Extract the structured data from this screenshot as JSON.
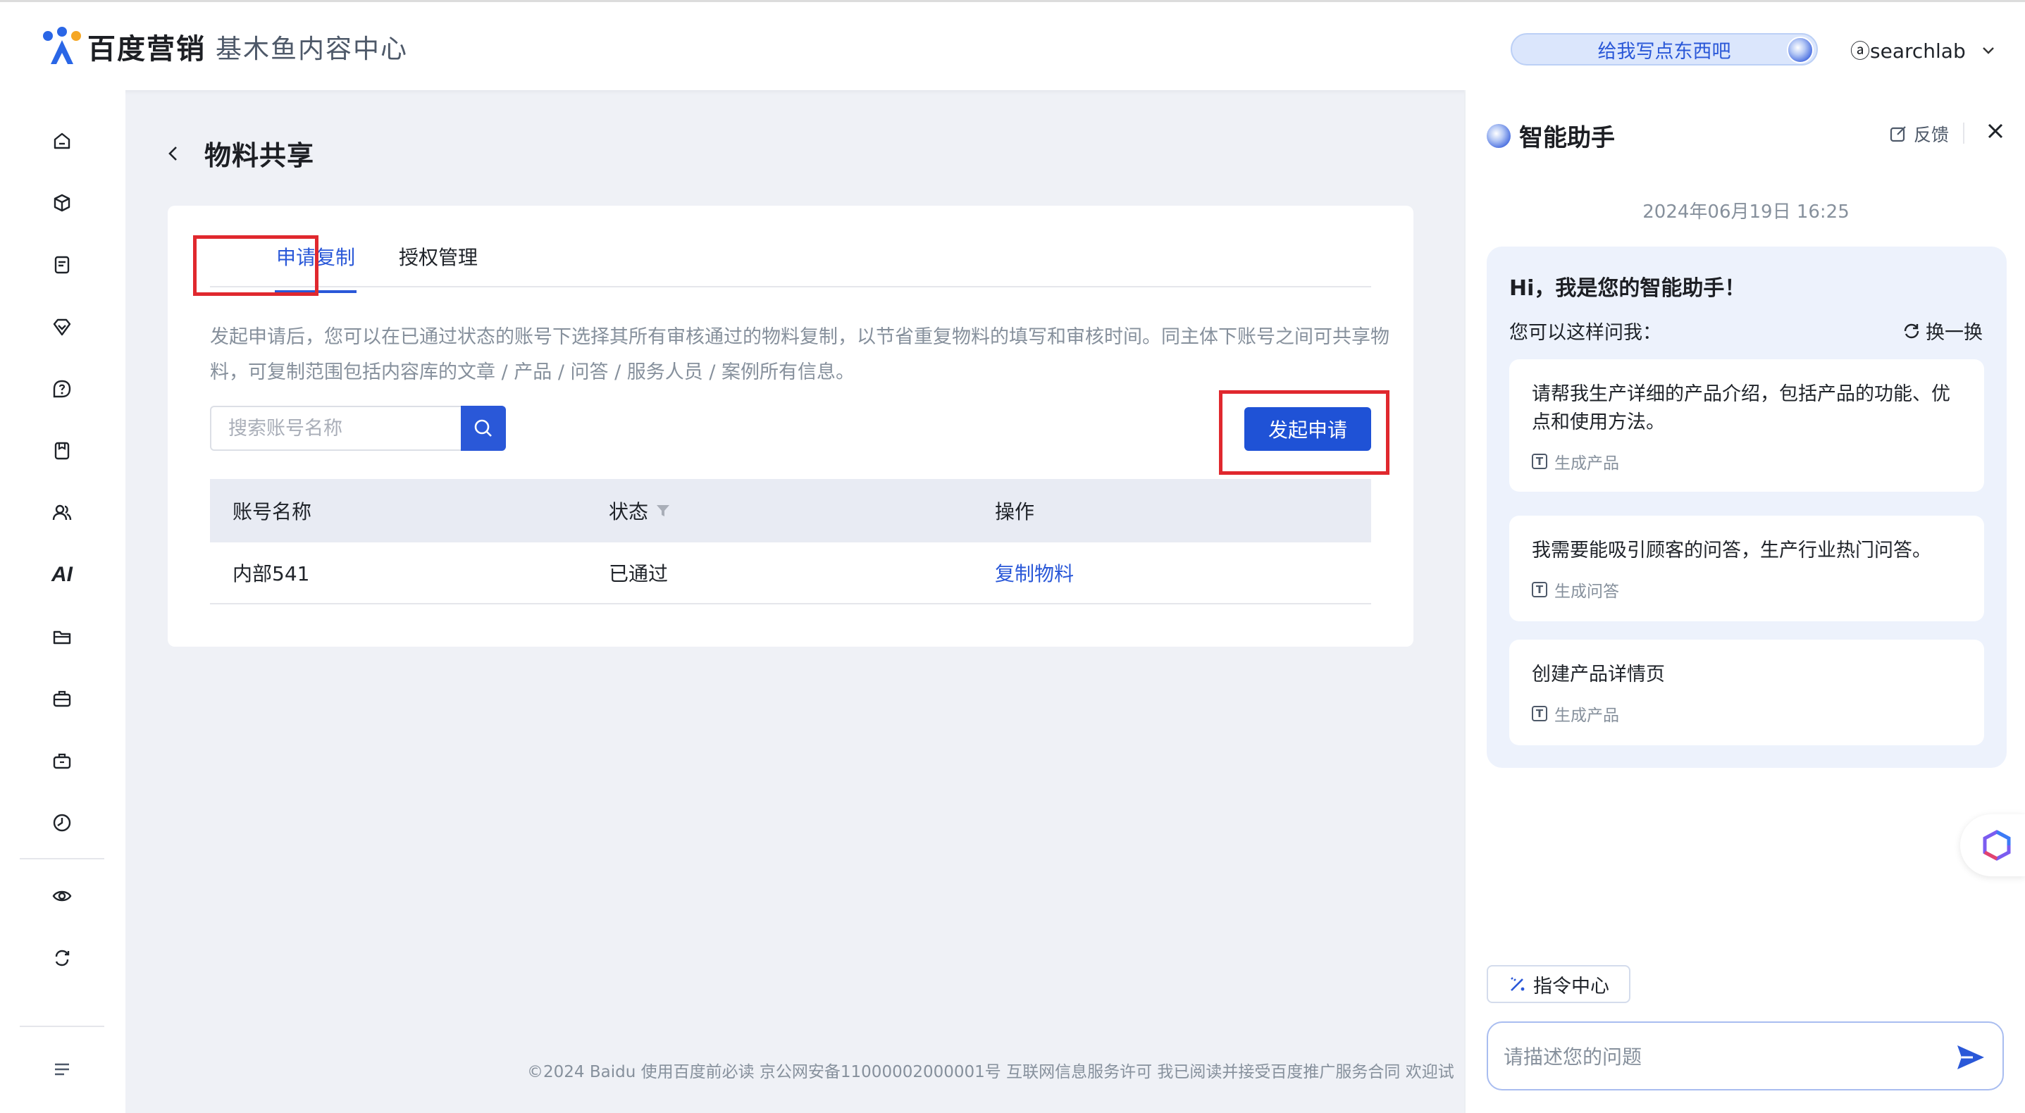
{
  "header": {
    "brand": "百度营销",
    "product": "基木鱼内容中心",
    "ask_prompt": "给我写点东西吧",
    "username": "ⓐsearchlab"
  },
  "sidebar": {
    "icons": [
      "home-icon",
      "cube-icon",
      "document-icon",
      "diamond-icon",
      "question-icon",
      "bookmark-icon",
      "users-icon",
      "ai-icon",
      "folder-icon",
      "briefcase-icon",
      "toolbox-icon",
      "clock-icon",
      "eye-icon",
      "refresh-cart-icon",
      "menu-icon"
    ],
    "ai_label": "AI"
  },
  "page": {
    "title": "物料共享"
  },
  "tabs": [
    {
      "label": "申请复制",
      "active": true
    },
    {
      "label": "授权管理",
      "active": false
    }
  ],
  "description": "发起申请后，您可以在已通过状态的账号下选择其所有审核通过的物料复制，以节省重复物料的填写和审核时间。同主体下账号之间可共享物料，可复制范围包括内容库的文章 / 产品 / 问答 / 服务人员 / 案例所有信息。",
  "search": {
    "placeholder": "搜索账号名称",
    "value": ""
  },
  "apply_button": "发起申请",
  "table": {
    "columns": [
      "账号名称",
      "状态",
      "操作"
    ],
    "rows": [
      {
        "account": "内部541",
        "status": "已通过",
        "action": "复制物料"
      }
    ]
  },
  "footer": "©2024 Baidu 使用百度前必读 京公网安备11000002000001号 互联网信息服务许可 我已阅读并接受百度推广服务合同 欢迎试",
  "assistant": {
    "title": "智能助手",
    "feedback": "反馈",
    "date": "2024年06月19日 16:25",
    "greeting": "Hi，我是您的智能助手！",
    "ask_hint": "您可以这样问我：",
    "refresh": "换一换",
    "suggestions": [
      {
        "text": "请帮我生产详细的产品介绍，包括产品的功能、优点和使用方法。",
        "tag": "生成产品"
      },
      {
        "text": "我需要能吸引顾客的问答，生产行业热门问答。",
        "tag": "生成问答"
      },
      {
        "text": "创建产品详情页",
        "tag": "生成产品"
      }
    ],
    "command_center": "指令中心",
    "input_placeholder": "请描述您的问题",
    "input_value": ""
  },
  "colors": {
    "accent": "#2a58d8",
    "highlight_box": "#e0282e",
    "background": "#eff1f6"
  }
}
